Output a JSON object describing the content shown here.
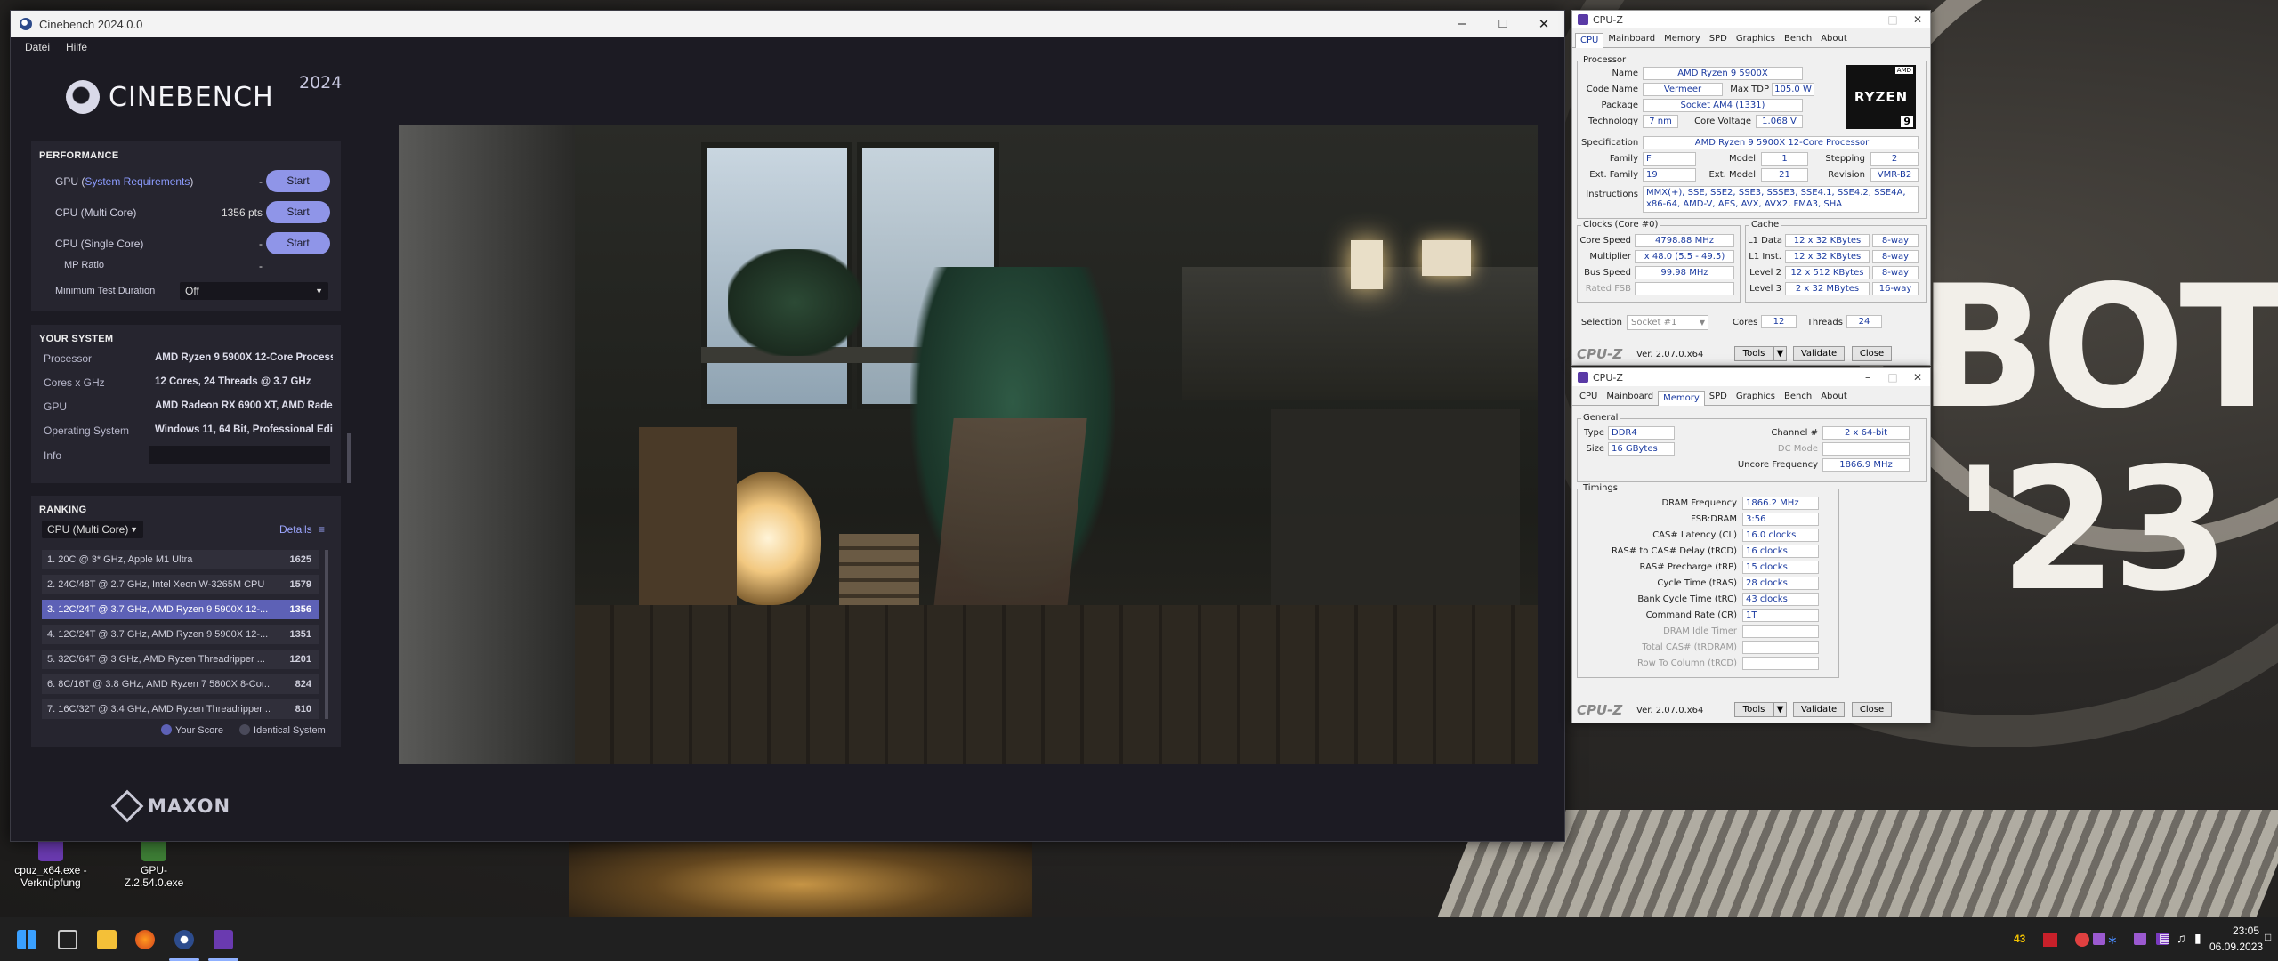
{
  "desktop": {
    "bg_text_1": "BOT",
    "bg_text_2": "'23",
    "icons": [
      {
        "label": "cpuz_x64.exe - Verknüpfung"
      },
      {
        "label": "GPU-Z.2.54.0.exe"
      }
    ]
  },
  "cinebench": {
    "window_title": "Cinebench 2024.0.0",
    "menu": [
      "Datei",
      "Hilfe"
    ],
    "logo_name": "CINEBENCH",
    "logo_year": "2024",
    "performance": {
      "heading": "PERFORMANCE",
      "gpu_label_pre": "GPU (",
      "gpu_label_link": "System Requirements",
      "gpu_label_post": ")",
      "gpu_value": "-",
      "cpu_multi_label": "CPU (Multi Core)",
      "cpu_multi_value": "1356 pts",
      "cpu_single_label": "CPU (Single Core)",
      "cpu_single_value": "-",
      "mp_ratio_label": "MP Ratio",
      "mp_ratio_value": "-",
      "min_duration_label": "Minimum Test Duration",
      "min_duration_value": "Off",
      "start_label": "Start"
    },
    "system": {
      "heading": "YOUR SYSTEM",
      "rows": [
        {
          "k": "Processor",
          "v": "AMD Ryzen 9 5900X 12-Core Process..."
        },
        {
          "k": "Cores x GHz",
          "v": "12 Cores, 24 Threads @ 3.7 GHz"
        },
        {
          "k": "GPU",
          "v": "AMD Radeon RX 6900 XT, AMD Rade..."
        },
        {
          "k": "Operating System",
          "v": "Windows 11, 64 Bit, Professional Edi..."
        },
        {
          "k": "Info",
          "v": ""
        }
      ]
    },
    "ranking": {
      "heading": "RANKING",
      "dropdown": "CPU (Multi Core)",
      "details": "Details",
      "rows": [
        {
          "t": "1. 20C @ 3* GHz, Apple M1 Ultra",
          "s": "1625"
        },
        {
          "t": "2. 24C/48T @ 2.7 GHz, Intel Xeon W-3265M CPU",
          "s": "1579"
        },
        {
          "t": "3. 12C/24T @ 3.7 GHz, AMD Ryzen 9 5900X 12-...",
          "s": "1356"
        },
        {
          "t": "4. 12C/24T @ 3.7 GHz, AMD Ryzen 9 5900X 12-...",
          "s": "1351"
        },
        {
          "t": "5. 32C/64T @ 3 GHz, AMD Ryzen Threadripper ...",
          "s": "1201"
        },
        {
          "t": "6. 8C/16T @ 3.8 GHz, AMD Ryzen 7 5800X 8-Cor...",
          "s": "824"
        },
        {
          "t": "7. 16C/32T @ 3.4 GHz, AMD Ryzen Threadripper ...",
          "s": "810"
        }
      ],
      "legend_your": "Your Score",
      "legend_identical": "Identical System"
    },
    "maxon": "MAXON"
  },
  "cpuz_cpu": {
    "title": "CPU-Z",
    "tabs": [
      "CPU",
      "Mainboard",
      "Memory",
      "SPD",
      "Graphics",
      "Bench",
      "About"
    ],
    "active_tab": "CPU",
    "processor_group": "Processor",
    "name_k": "Name",
    "name_v": "AMD Ryzen 9 5900X",
    "codename_k": "Code Name",
    "codename_v": "Vermeer",
    "tdp_k": "Max TDP",
    "tdp_v": "105.0 W",
    "package_k": "Package",
    "package_v": "Socket AM4 (1331)",
    "tech_k": "Technology",
    "tech_v": "7 nm",
    "voltage_k": "Core Voltage",
    "voltage_v": "1.068 V",
    "spec_k": "Specification",
    "spec_v": "AMD Ryzen 9 5900X 12-Core Processor",
    "family_k": "Family",
    "family_v": "F",
    "model_k": "Model",
    "model_v": "1",
    "stepping_k": "Stepping",
    "stepping_v": "2",
    "extfam_k": "Ext. Family",
    "extfam_v": "19",
    "extmodel_k": "Ext. Model",
    "extmodel_v": "21",
    "revision_k": "Revision",
    "revision_v": "VMR-B2",
    "instr_k": "Instructions",
    "instr_v1": "MMX(+), SSE, SSE2, SSE3, SSSE3, SSE4.1, SSE4.2, SSE4A,",
    "instr_v2": "x86-64, AMD-V, AES, AVX, AVX2, FMA3, SHA",
    "logo_brand": "AMD",
    "logo_text": "RYZEN",
    "logo_num": "9",
    "clocks_group": "Clocks (Core #0)",
    "corespeed_k": "Core Speed",
    "corespeed_v": "4798.88 MHz",
    "mult_k": "Multiplier",
    "mult_v": "x 48.0 (5.5 - 49.5)",
    "bus_k": "Bus Speed",
    "bus_v": "99.98 MHz",
    "fsb_k": "Rated FSB",
    "fsb_v": "",
    "cache_group": "Cache",
    "l1d_k": "L1 Data",
    "l1d_v": "12 x 32 KBytes",
    "l1d_w": "8-way",
    "l1i_k": "L1 Inst.",
    "l1i_v": "12 x 32 KBytes",
    "l1i_w": "8-way",
    "l2_k": "Level 2",
    "l2_v": "12 x 512 KBytes",
    "l2_w": "8-way",
    "l3_k": "Level 3",
    "l3_v": "2 x 32 MBytes",
    "l3_w": "16-way",
    "selection_k": "Selection",
    "selection_v": "Socket #1",
    "cores_k": "Cores",
    "cores_v": "12",
    "threads_k": "Threads",
    "threads_v": "24",
    "brand": "CPU-Z",
    "version": "Ver. 2.07.0.x64",
    "tools": "Tools",
    "validate": "Validate",
    "close": "Close"
  },
  "cpuz_mem": {
    "title": "CPU-Z",
    "tabs": [
      "CPU",
      "Mainboard",
      "Memory",
      "SPD",
      "Graphics",
      "Bench",
      "About"
    ],
    "active_tab": "Memory",
    "general_group": "General",
    "type_k": "Type",
    "type_v": "DDR4",
    "size_k": "Size",
    "size_v": "16 GBytes",
    "channel_k": "Channel #",
    "channel_v": "2 x 64-bit",
    "dcmode_k": "DC Mode",
    "dcmode_v": "",
    "uncore_k": "Uncore Frequency",
    "uncore_v": "1866.9 MHz",
    "timings_group": "Timings",
    "timings": [
      {
        "k": "DRAM Frequency",
        "v": "1866.2 MHz",
        "grey": false
      },
      {
        "k": "FSB:DRAM",
        "v": "3:56",
        "grey": false
      },
      {
        "k": "CAS# Latency (CL)",
        "v": "16.0 clocks",
        "grey": false
      },
      {
        "k": "RAS# to CAS# Delay (tRCD)",
        "v": "16 clocks",
        "grey": false
      },
      {
        "k": "RAS# Precharge (tRP)",
        "v": "15 clocks",
        "grey": false
      },
      {
        "k": "Cycle Time (tRAS)",
        "v": "28 clocks",
        "grey": false
      },
      {
        "k": "Bank Cycle Time (tRC)",
        "v": "43 clocks",
        "grey": false
      },
      {
        "k": "Command Rate (CR)",
        "v": "1T",
        "grey": false
      },
      {
        "k": "DRAM Idle Timer",
        "v": "",
        "grey": true
      },
      {
        "k": "Total CAS# (tRDRAM)",
        "v": "",
        "grey": true
      },
      {
        "k": "Row To Column (tRCD)",
        "v": "",
        "grey": true
      }
    ],
    "brand": "CPU-Z",
    "version": "Ver. 2.07.0.x64",
    "tools": "Tools",
    "validate": "Validate",
    "close": "Close"
  },
  "taskbar": {
    "temp": "43",
    "time": "23:05",
    "date": "06.09.2023"
  }
}
